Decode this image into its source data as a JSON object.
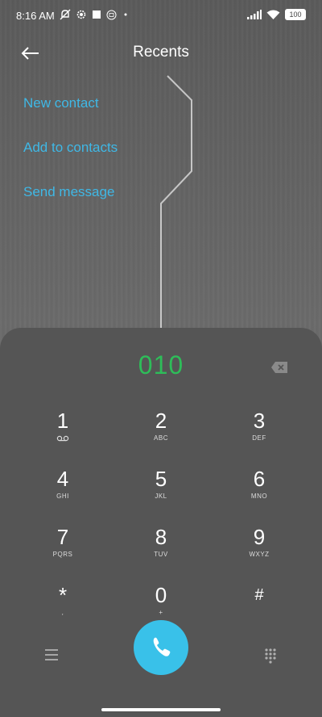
{
  "status_bar": {
    "time": "8:16 AM",
    "battery": "100",
    "icons": [
      "mute-icon",
      "settings-icon",
      "square-icon",
      "mi-icon",
      "dot-icon",
      "signal-icon",
      "wifi-icon",
      "battery-icon"
    ]
  },
  "header": {
    "title": "Recents",
    "back_icon": "arrow-left-icon"
  },
  "menu": {
    "new_contact": "New contact",
    "add_to_contacts": "Add to contacts",
    "send_message": "Send message"
  },
  "dialer": {
    "number": "010",
    "keys": [
      {
        "digit": "1",
        "letters": ""
      },
      {
        "digit": "2",
        "letters": "ABC"
      },
      {
        "digit": "3",
        "letters": "DEF"
      },
      {
        "digit": "4",
        "letters": "GHI"
      },
      {
        "digit": "5",
        "letters": "JKL"
      },
      {
        "digit": "6",
        "letters": "MNO"
      },
      {
        "digit": "7",
        "letters": "PQRS"
      },
      {
        "digit": "8",
        "letters": "TUV"
      },
      {
        "digit": "9",
        "letters": "WXYZ"
      },
      {
        "digit": "*",
        "letters": ","
      },
      {
        "digit": "0",
        "letters": "+"
      },
      {
        "digit": "#",
        "letters": ""
      }
    ]
  },
  "colors": {
    "accent_blue": "#3fb8e6",
    "number_green": "#2ebd59",
    "call_button": "#39c1e9",
    "pad_bg": "#555555"
  }
}
